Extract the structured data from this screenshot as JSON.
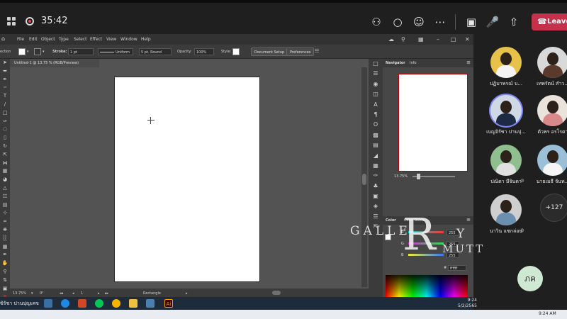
{
  "meeting": {
    "timer": "35:42",
    "leave_label": "Leave"
  },
  "illustrator": {
    "menu": [
      "File",
      "Edit",
      "Object",
      "Type",
      "Select",
      "Effect",
      "View",
      "Window",
      "Help"
    ],
    "control": {
      "selection_label": "ection",
      "stroke_label": "Stroke:",
      "stroke_weight": "1 pt",
      "stroke_profile": "Uniform",
      "brush": "5 pt. Round",
      "opacity_label": "Opacity:",
      "opacity_value": "100%",
      "style_label": "Style:",
      "document_setup": "Document Setup",
      "preferences": "Preferences"
    },
    "doc_tab": "Untitled-1 @ 13.75 % (RGB/Preview)",
    "status": {
      "zoom": "13.75%",
      "rotation": "0°",
      "artboard": "1",
      "tool": "Rectangle"
    },
    "panels": {
      "navigator_tab": "Navigator",
      "info_tab": "Info",
      "nav_zoom": "13.75%",
      "color_tab": "Color",
      "color_guide_tab": "Color Guide",
      "rgb": [
        {
          "label": "R",
          "value": "255",
          "color": "#ff3b3b"
        },
        {
          "label": "G",
          "value": "255",
          "color": "#3bdc5a"
        },
        {
          "label": "B",
          "value": "255",
          "color": "#3b7bff"
        }
      ],
      "hex_value": "ffffff"
    }
  },
  "participants": [
    {
      "name": "ปฏิมาพรณ์ บ..."
    },
    {
      "name": "เทพรัตน์ สำว..."
    },
    {
      "name": "เบญจิรัชา ปานปุ..."
    },
    {
      "name": "ตัวพร อรโรดา"
    },
    {
      "name": "ปณิดา มีจินดา"
    },
    {
      "name": "นายเมธี จันท..."
    },
    {
      "name": "นาวิน แซกล่อน"
    }
  ],
  "more_count": "+127",
  "self_initials": "ภค",
  "watermark": {
    "galle": "GALLE",
    "big_r": "R",
    "y": "Y",
    "mutt": "MUTT"
  },
  "taskbar": {
    "user_name": "ซิรัชา ปานปุญเคข",
    "time": "9:24",
    "date": "5/2/2565",
    "outer_time": "9:24 AM"
  }
}
